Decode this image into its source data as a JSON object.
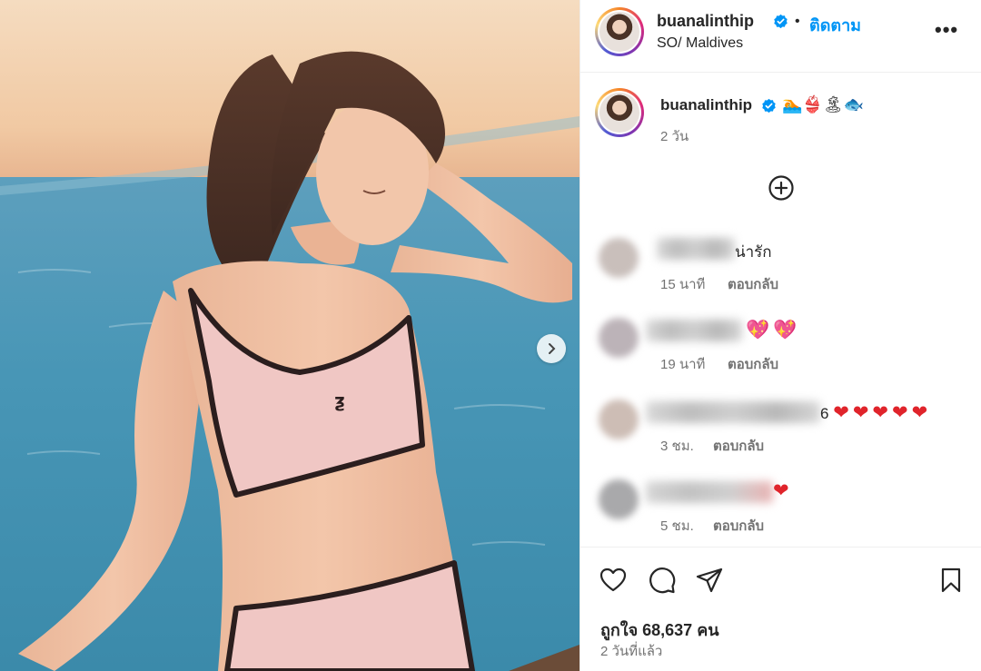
{
  "post": {
    "username": "buanalinthip",
    "follow_label": "ติดตาม",
    "separator": "•",
    "location": "SO/ Maldives",
    "more_label": "•••",
    "caption_emojis": "🏊👙🏝🐟",
    "caption_time": "2 วัน",
    "likes_text": "ถูกใจ 68,637 คน",
    "posted_time": "2 วันที่แล้ว"
  },
  "comments": [
    {
      "text": "น่ารัก",
      "time": "15 นาที",
      "reply": "ตอบกลับ",
      "hearts": 0
    },
    {
      "text": "",
      "time": "19 นาที",
      "reply": "ตอบกลับ",
      "hearts": 2
    },
    {
      "text": "6",
      "time": "3 ชม.",
      "reply": "ตอบกลับ",
      "hearts": 5
    },
    {
      "text": "",
      "time": "5 ชม.",
      "reply": "ตอบกลับ",
      "hearts": 1
    }
  ],
  "icons": [
    "verified-icon",
    "more-icon",
    "add-comment-icon",
    "heart-icon",
    "comment-icon",
    "share-icon",
    "bookmark-icon",
    "chevron-right-icon"
  ],
  "colors": {
    "accent": "#0095f6",
    "heart": "#e0242b",
    "muted": "#737373"
  }
}
